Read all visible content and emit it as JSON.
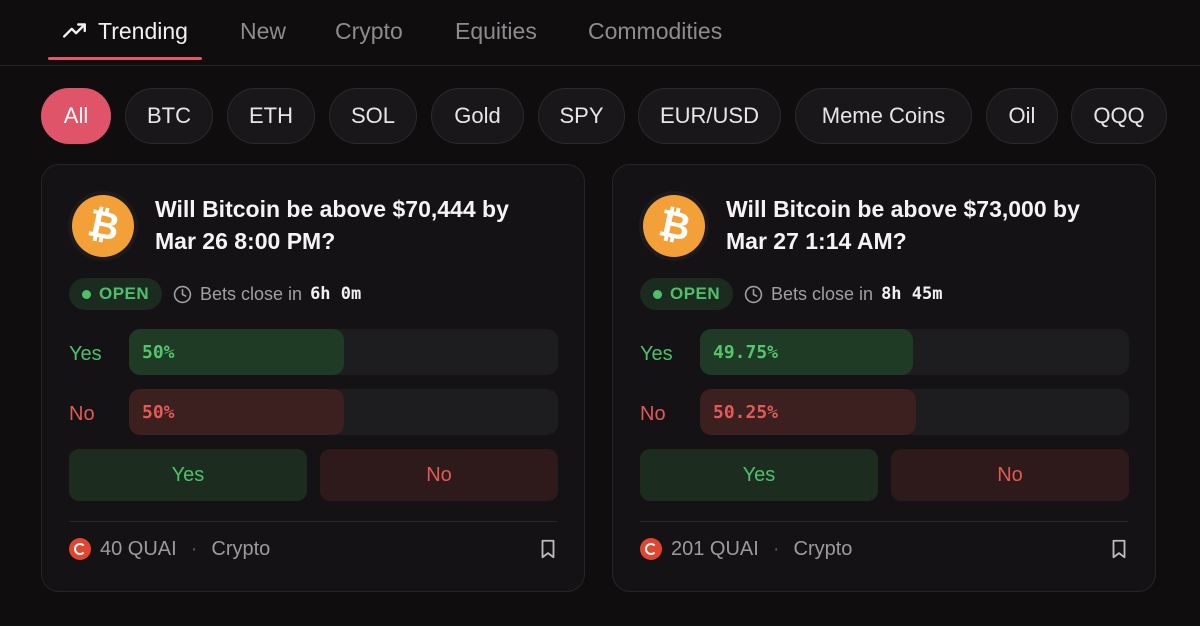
{
  "tabs": [
    {
      "label": "Trending",
      "active": true,
      "icon": "trending-up-icon"
    },
    {
      "label": "New",
      "active": false
    },
    {
      "label": "Crypto",
      "active": false
    },
    {
      "label": "Equities",
      "active": false
    },
    {
      "label": "Commodities",
      "active": false
    }
  ],
  "filters": [
    "All",
    "BTC",
    "ETH",
    "SOL",
    "Gold",
    "SPY",
    "EUR/USD",
    "Meme Coins",
    "Oil",
    "QQQ"
  ],
  "active_filter": "All",
  "colors": {
    "accent": "#df5469",
    "yes": "#4fc06a",
    "no": "#e05a55",
    "bitcoin": "#f3a039",
    "quai": "#e2452f"
  },
  "cards": [
    {
      "icon": "bitcoin-icon",
      "question": "Will Bitcoin be above $70,444 by Mar 26 8:00 PM?",
      "status": "OPEN",
      "close_label": "Bets close in",
      "close_time": "6h 0m",
      "yes_label": "Yes",
      "no_label": "No",
      "yes_pct": "50%",
      "no_pct": "50%",
      "yes_value": 50,
      "no_value": 50,
      "yes_button": "Yes",
      "no_button": "No",
      "pool": "40 QUAI",
      "category": "Crypto"
    },
    {
      "icon": "bitcoin-icon",
      "question": "Will Bitcoin be above $73,000 by Mar 27 1:14 AM?",
      "status": "OPEN",
      "close_label": "Bets close in",
      "close_time": "8h 45m",
      "yes_label": "Yes",
      "no_label": "No",
      "yes_pct": "49.75%",
      "no_pct": "50.25%",
      "yes_value": 49.75,
      "no_value": 50.25,
      "yes_button": "Yes",
      "no_button": "No",
      "pool": "201 QUAI",
      "category": "Crypto"
    }
  ]
}
